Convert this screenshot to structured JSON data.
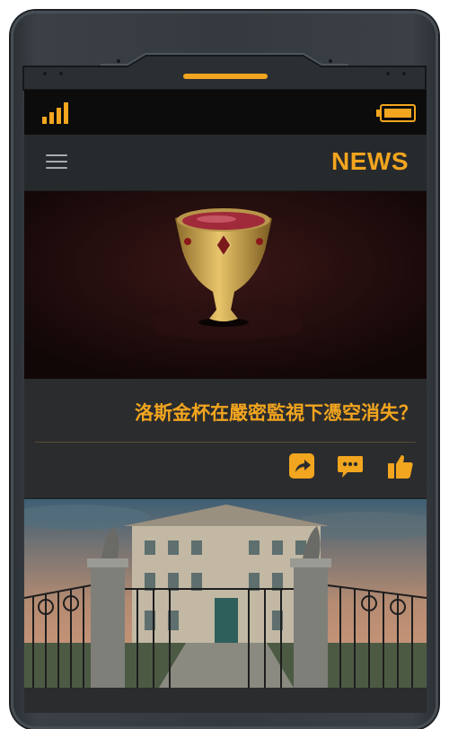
{
  "app": {
    "title": "NEWS",
    "accent_color": "#f2a51e",
    "background_color": "#222427"
  },
  "status_bar": {
    "signal_icon": "signal-bars-icon",
    "battery_icon": "battery-icon"
  },
  "header": {
    "menu_icon": "hamburger-menu-icon",
    "title": "NEWS"
  },
  "articles": [
    {
      "image": "golden-goblet-image",
      "headline": "洛斯金杯在嚴密監視下憑空消失？",
      "actions": [
        {
          "name": "share",
          "icon": "share-icon"
        },
        {
          "name": "comment",
          "icon": "comment-icon"
        },
        {
          "name": "like",
          "icon": "thumbs-up-icon"
        }
      ]
    },
    {
      "image": "mansion-gate-image"
    }
  ]
}
